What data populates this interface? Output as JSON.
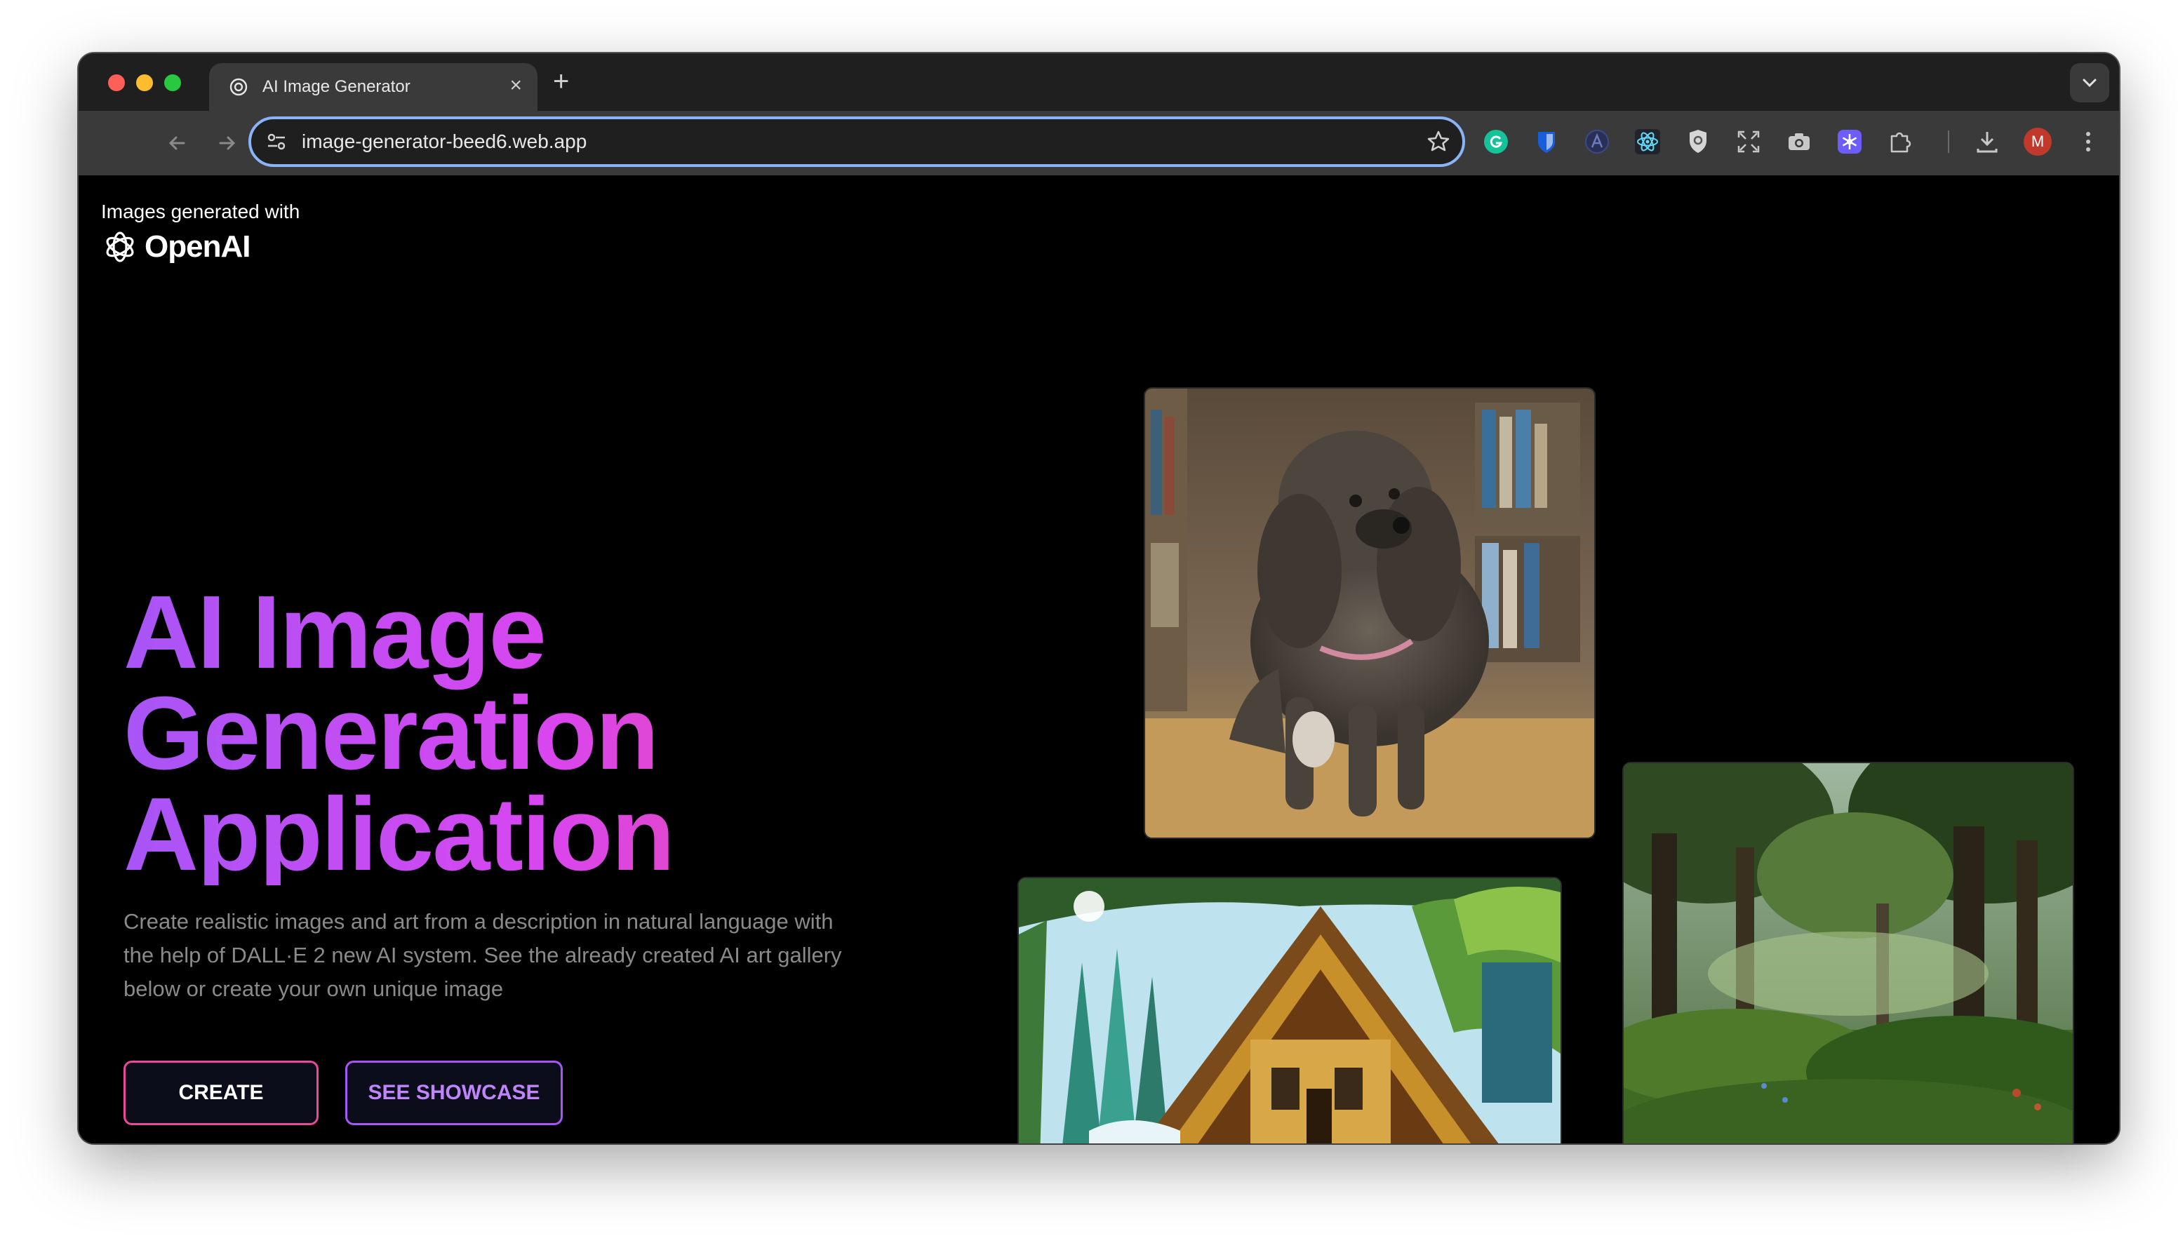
{
  "browser": {
    "tab_title": "AI Image Generator",
    "tab_close": "×",
    "new_tab": "+",
    "url": "image-generator-beed6.web.app",
    "profile_initial": "M",
    "extension_icons": [
      "grammarly-icon",
      "bitwarden-shield-icon",
      "a-logo-icon",
      "react-icon",
      "privacy-shield-icon",
      "expand-icon",
      "camera-icon",
      "snowflake-icon",
      "puzzle-icon",
      "download-icon",
      "profile-avatar",
      "more-menu-icon"
    ]
  },
  "page": {
    "brand_caption": "Images generated with",
    "brand_name": "OpenAI",
    "hero_line1": "AI Image",
    "hero_line2": "Generation",
    "hero_line3": "Application",
    "description": "Create realistic images and art from a description in natural language with the help of DALL·E 2 new AI system. See the already created AI art gallery below or create your own unique image",
    "create_button": "CREATE",
    "showcase_button": "SEE SHOWCASE",
    "gallery": [
      "poodle in library photo",
      "fantasy wooden cabin painting",
      "sunlit forest landscape"
    ]
  },
  "colors": {
    "gradient_start": "#a855f7",
    "gradient_end": "#ec4899",
    "url_focus_ring": "#8ab4f8"
  }
}
